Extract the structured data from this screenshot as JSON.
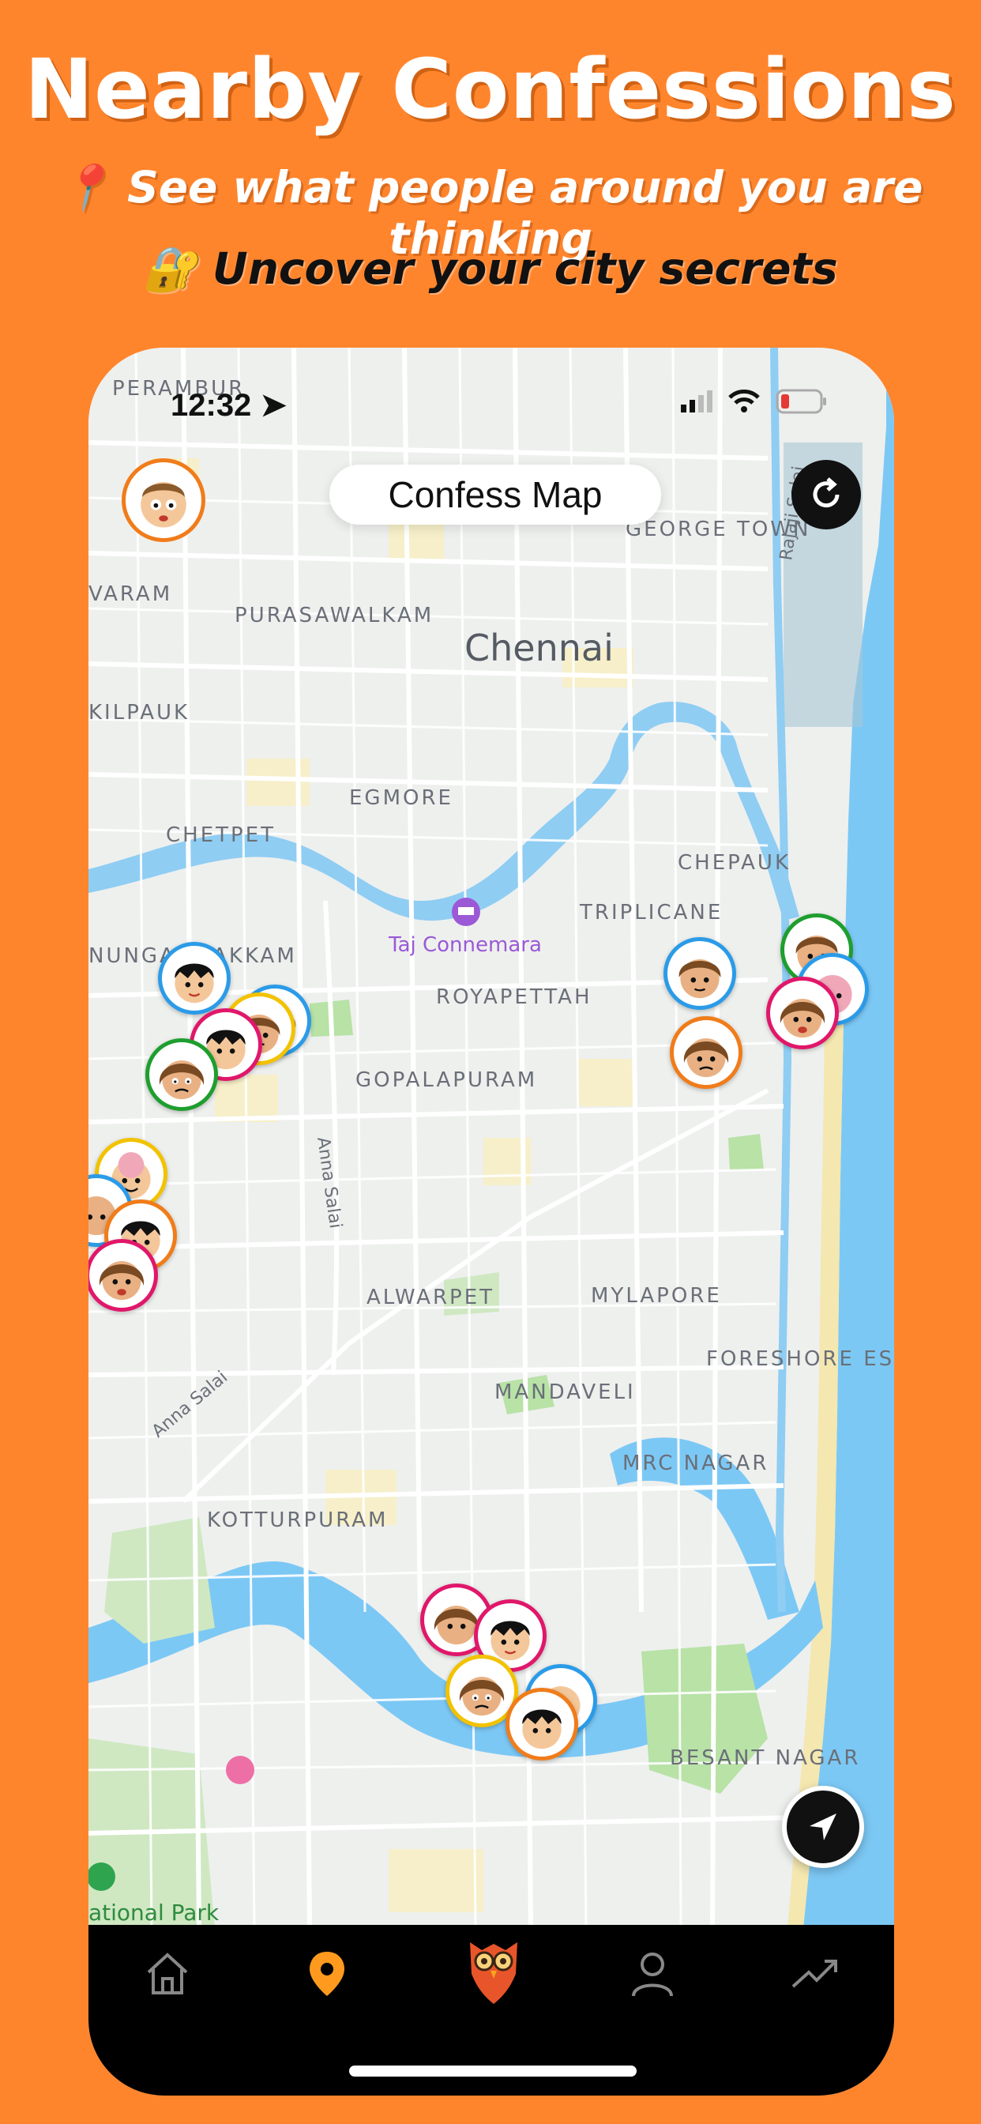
{
  "promo": {
    "title": "Nearby Confessions",
    "subtitle1": "📍 See what people around you are thinking",
    "subtitle2": "🔐 Uncover your city secrets"
  },
  "status_bar": {
    "time": "12:32"
  },
  "header": {
    "title": "Confess Map"
  },
  "map": {
    "city": "Chennai",
    "areas": [
      "PERAMBUR",
      "GEORGE TOWN",
      "VARAM",
      "PURASAWALKAM",
      "KILPAUK",
      "EGMORE",
      "CHETPET",
      "CHEPAUK",
      "TRIPLICANE",
      "NUNGAMBAKKAM",
      "ROYAPETTAH",
      "GOPALAPURAM",
      "ALWARPET",
      "MYLAPORE",
      "FORESHORE ESTATE",
      "MANDAVELI",
      "MRC NAGAR",
      "KOTTURPURAM",
      "BESANT NAGAR"
    ],
    "roads": [
      "Rajaji Salai",
      "Anna Salai",
      "Anna Salai"
    ],
    "poi": [
      "Taj Connemara",
      "ational Park"
    ]
  },
  "colors": {
    "background": "#ff852d",
    "marker_blue": "#2b9be8",
    "marker_orange": "#f07c1a",
    "marker_pink": "#e0176a",
    "marker_green": "#1e9e2e",
    "marker_yellow": "#f2c200",
    "water": "#7cc8f5"
  },
  "tabs": [
    {
      "name": "home",
      "icon": "home-icon"
    },
    {
      "name": "map",
      "icon": "map-pin-icon",
      "active": true
    },
    {
      "name": "owl",
      "icon": "owl-logo-icon"
    },
    {
      "name": "profile",
      "icon": "person-icon"
    },
    {
      "name": "trending",
      "icon": "trending-icon"
    }
  ]
}
